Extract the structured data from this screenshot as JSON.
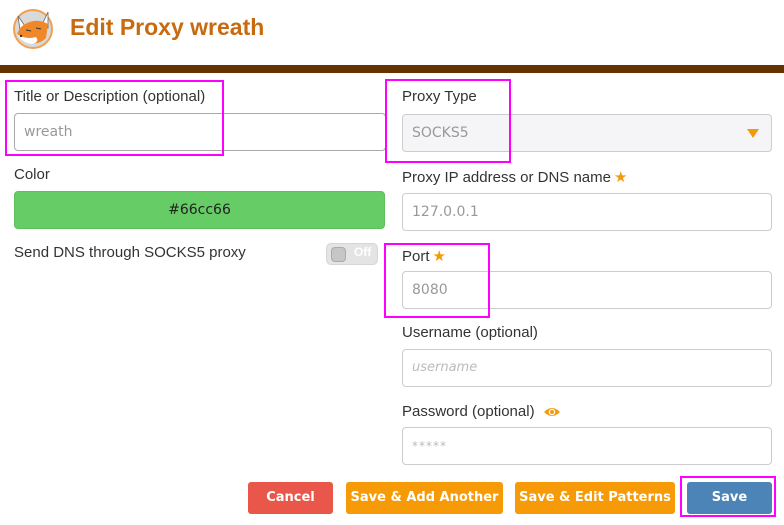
{
  "header": {
    "title": "Edit Proxy wreath",
    "logo_icon": "foxyproxy-fox-logo"
  },
  "form": {
    "title_field": {
      "label": "Title or Description (optional)",
      "value": "wreath"
    },
    "color": {
      "label": "Color",
      "value": "#66cc66"
    },
    "send_dns": {
      "label": "Send DNS through SOCKS5 proxy",
      "toggle_state": "Off"
    },
    "proxy_type": {
      "label": "Proxy Type",
      "selected": "SOCKS5"
    },
    "proxy_address": {
      "label": "Proxy IP address or DNS name",
      "required_icon": "star-icon",
      "value": "127.0.0.1"
    },
    "port": {
      "label": "Port",
      "required_icon": "star-icon",
      "value": "8080"
    },
    "username": {
      "label": "Username (optional)",
      "placeholder": "username"
    },
    "password": {
      "label": "Password (optional)",
      "toggle_icon": "eye-icon",
      "placeholder": "*****"
    }
  },
  "buttons": {
    "cancel": "Cancel",
    "save_add_another": "Save & Add Another",
    "save_edit_patterns": "Save & Edit Patterns",
    "save": "Save"
  },
  "colors": {
    "title": "#c86a0e",
    "header_bar": "#663300",
    "cancel": "#e9574a",
    "secondary_save": "#f79a07",
    "primary_save": "#4d84b8",
    "accent_star": "#f29a0e"
  }
}
